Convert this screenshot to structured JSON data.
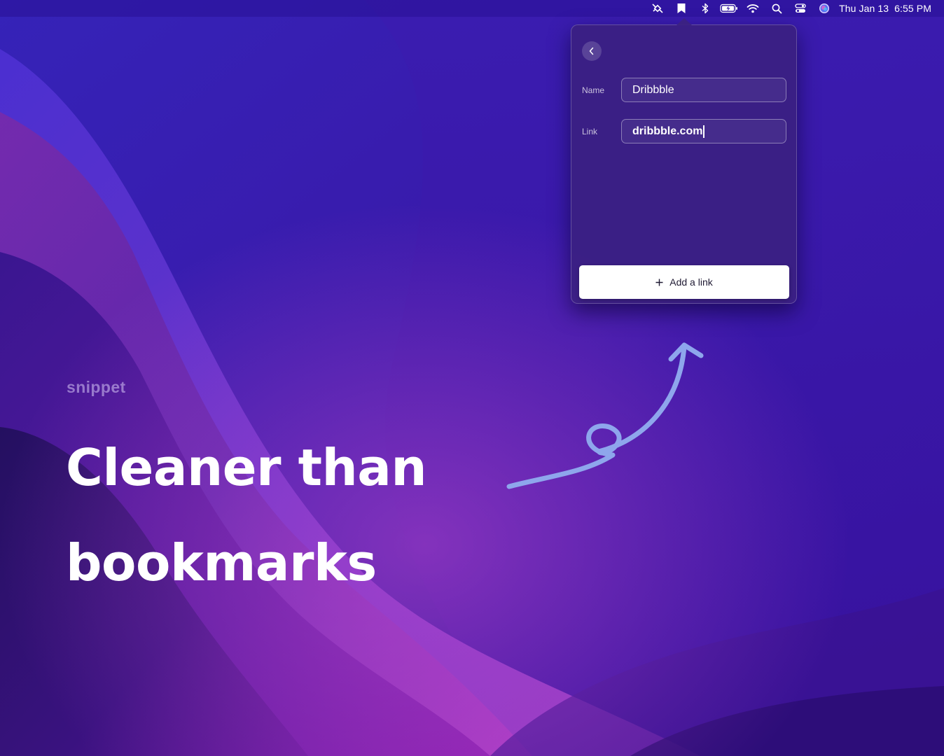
{
  "menubar": {
    "icons": [
      "satellite-icon",
      "bookmark-icon",
      "bluetooth-icon",
      "battery-icon",
      "wifi-icon",
      "search-icon",
      "control-center-icon",
      "siri-icon"
    ],
    "day_date": "Thu Jan 13",
    "time": "6:55 PM"
  },
  "popover": {
    "back_icon": "chevron-left-icon",
    "name_label": "Name",
    "name_value": "Dribbble",
    "link_label": "Link",
    "link_value": "dribbble.com",
    "add_icon": "plus-icon",
    "add_button_label": "Add a link"
  },
  "marketing": {
    "brand": "snippet",
    "headline_line1": "Cleaner than",
    "headline_line2": "bookmarks",
    "annotation": "curved-arrow-pointing-up"
  },
  "colors": {
    "wallpaper_deep": "#2a0f8f",
    "wallpaper_magenta": "#8a2bb8",
    "popover_bg": "#3a2080",
    "button_bg": "#ffffff",
    "arrow_stroke": "#8ea6ec"
  }
}
